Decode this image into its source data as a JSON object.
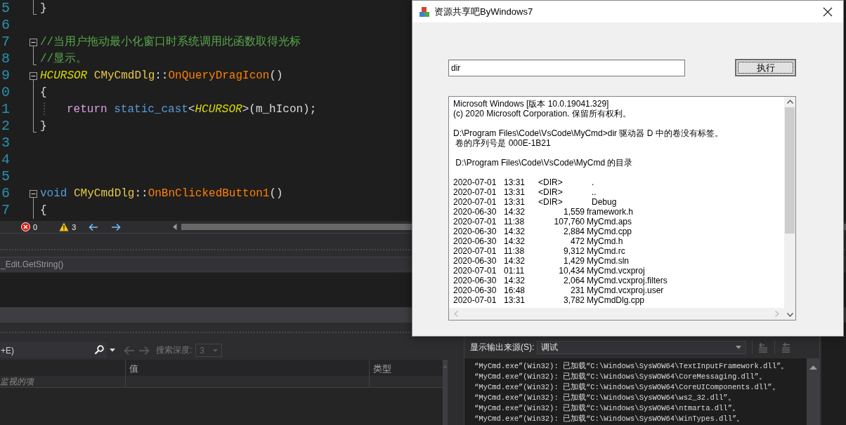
{
  "editor": {
    "lines": [
      {
        "number": "5",
        "kind": "fold_end",
        "indented": false,
        "tokens": [
          {
            "kind": "plain",
            "text": "}"
          }
        ]
      },
      {
        "number": "6",
        "kind": "plain"
      },
      {
        "number": "7",
        "kind": "fold_start",
        "indented": false,
        "tokens": [
          {
            "kind": "comment",
            "text": "//当用户拖动最小化窗口时系统调用此函数取得光标"
          }
        ]
      },
      {
        "number": "8",
        "kind": "fold_end",
        "indented": false,
        "tokens": [
          {
            "kind": "comment",
            "text": "//显示。"
          }
        ]
      },
      {
        "number": "9",
        "kind": "fold_start",
        "indented": false,
        "tokens": [
          {
            "kind": "type",
            "text": "HCURSOR "
          },
          {
            "kind": "class",
            "text": "CMyCmdDlg"
          },
          {
            "kind": "plain",
            "text": "::"
          },
          {
            "kind": "func",
            "text": "OnQueryDragIcon"
          },
          {
            "kind": "plain",
            "text": "()"
          }
        ]
      },
      {
        "number": "0",
        "kind": "fold_line",
        "indented": false,
        "tokens": [
          {
            "kind": "plain",
            "text": "{"
          }
        ]
      },
      {
        "number": "1",
        "kind": "fold_line",
        "indented": true,
        "tokens": [
          {
            "kind": "control",
            "text": "return "
          },
          {
            "kind": "keyword",
            "text": "static_cast"
          },
          {
            "kind": "plain",
            "text": "<"
          },
          {
            "kind": "type",
            "text": "HCURSOR"
          },
          {
            "kind": "plain",
            "text": ">(m_hIcon);"
          }
        ]
      },
      {
        "number": "2",
        "kind": "fold_end",
        "indented": false,
        "tokens": [
          {
            "kind": "plain",
            "text": "}"
          }
        ]
      },
      {
        "number": "3",
        "kind": "plain"
      },
      {
        "number": "4",
        "kind": "plain"
      },
      {
        "number": "5",
        "kind": "plain"
      },
      {
        "number": "6",
        "kind": "fold_start",
        "indented": false,
        "tokens": [
          {
            "kind": "keyword",
            "text": "void "
          },
          {
            "kind": "class",
            "text": "CMyCmdDlg"
          },
          {
            "kind": "plain",
            "text": "::"
          },
          {
            "kind": "func",
            "text": "OnBnClickedButton1"
          },
          {
            "kind": "plain",
            "text": "()"
          }
        ]
      },
      {
        "number": "7",
        "kind": "fold_line",
        "indented": false,
        "tokens": [
          {
            "kind": "plain",
            "text": "{"
          }
        ]
      }
    ]
  },
  "status_strip": {
    "errors": "0",
    "warnings": "3"
  },
  "expression_bar": {
    "text": "_Edit.GetString()"
  },
  "watch": {
    "search_placeholder": "+E)",
    "depth_label": "搜索深度:",
    "depth": "3",
    "columns": [
      {
        "label": "值"
      },
      {
        "label": "类型"
      }
    ],
    "rows": [
      {
        "name": "监视的项"
      }
    ]
  },
  "output": {
    "source_label": "显示输出来源(S):",
    "source": "调试",
    "lines": [
      "“MyCmd.exe”(Win32): 已加载“C:\\Windows\\SysWOW64\\TextInputFramework.dll”。",
      "“MyCmd.exe”(Win32): 已加载“C:\\Windows\\SysWOW64\\CoreMessaging.dll”。",
      "“MyCmd.exe”(Win32): 已加载“C:\\Windows\\SysWOW64\\CoreUIComponents.dll”。",
      "“MyCmd.exe”(Win32): 已加载“C:\\Windows\\SysWOW64\\ws2_32.dll”。",
      "“MyCmd.exe”(Win32): 已加载“C:\\Windows\\SysWOW64\\ntmarta.dll”。",
      "“MyCmd.exe”(Win32): 已加载“C:\\Windows\\SysWOW64\\WinTypes.dll”。"
    ]
  },
  "dialog": {
    "title": "资源共享吧ByWindows7",
    "command": "dir",
    "button": "执行",
    "console": {
      "blocks": [
        [
          "Microsoft Windows [版本 10.0.19041.329]",
          "(c) 2020 Microsoft Corporation. 保留所有权利。"
        ],
        [
          "D:\\Program Files\\Code\\VsCode\\MyCmd>dir 驱动器 D 中的卷没有标签。",
          " 卷的序列号是 000E-1B21"
        ],
        [
          " D:\\Program Files\\Code\\VsCode\\MyCmd 的目录"
        ]
      ],
      "entries": [
        {
          "date": "2020-07-01",
          "time": "13:31",
          "dir": "<DIR>",
          "name": "."
        },
        {
          "date": "2020-07-01",
          "time": "13:31",
          "dir": "<DIR>",
          "name": ".."
        },
        {
          "date": "2020-07-01",
          "time": "13:31",
          "dir": "<DIR>",
          "name": "Debug"
        },
        {
          "date": "2020-06-30",
          "time": "14:32",
          "size": "1,559",
          "name": "framework.h"
        },
        {
          "date": "2020-07-01",
          "time": "11:38",
          "size": "107,760",
          "name": "MyCmd.aps"
        },
        {
          "date": "2020-06-30",
          "time": "14:32",
          "size": "2,884",
          "name": "MyCmd.cpp"
        },
        {
          "date": "2020-06-30",
          "time": "14:32",
          "size": "472",
          "name": "MyCmd.h"
        },
        {
          "date": "2020-07-01",
          "time": "11:38",
          "size": "9,312",
          "name": "MyCmd.rc"
        },
        {
          "date": "2020-06-30",
          "time": "14:32",
          "size": "1,429",
          "name": "MyCmd.sln"
        },
        {
          "date": "2020-07-01",
          "time": "01:11",
          "size": "10,434",
          "name": "MyCmd.vcxproj"
        },
        {
          "date": "2020-06-30",
          "time": "14:32",
          "size": "2,064",
          "name": "MyCmd.vcxproj.filters"
        },
        {
          "date": "2020-06-30",
          "time": "16:48",
          "size": "231",
          "name": "MyCmd.vcxproj.user"
        },
        {
          "date": "2020-07-01",
          "time": "13:31",
          "size": "3,782",
          "name": "MyCmdDlg.cpp"
        }
      ]
    }
  }
}
